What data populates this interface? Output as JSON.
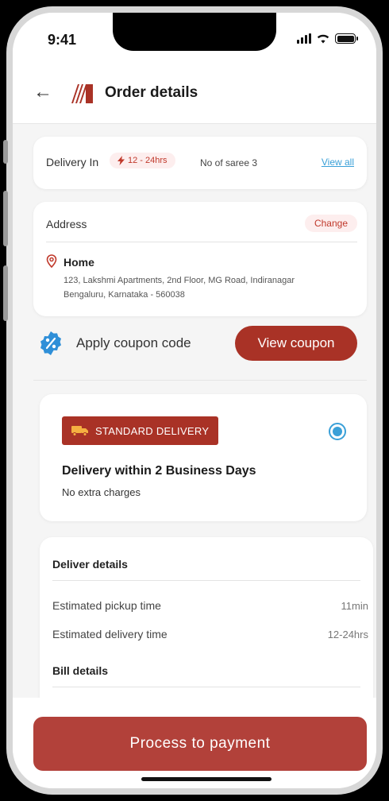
{
  "status": {
    "time": "9:41"
  },
  "header": {
    "title": "Order details"
  },
  "delivery_summary": {
    "label": "Delivery In",
    "eta": "12 - 24hrs",
    "count_text": "No of saree 3",
    "view_all": "View all"
  },
  "address": {
    "label": "Address",
    "change": "Change",
    "name": "Home",
    "line1": "123, Lakshmi Apartments, 2nd Floor, MG Road, Indiranagar",
    "line2": "Bengaluru, Karnataka - 560038"
  },
  "coupon": {
    "text": "Apply coupon code",
    "button": "View coupon"
  },
  "delivery_option": {
    "badge": "STANDARD DELIVERY",
    "title": "Delivery within 2 Business Days",
    "subtitle": "No extra charges",
    "selected": true
  },
  "details": {
    "deliver_heading": "Deliver details",
    "rows": [
      {
        "label": "Estimated pickup time",
        "value": "11min"
      },
      {
        "label": "Estimated delivery time",
        "value": "12-24hrs"
      }
    ],
    "bill_heading": "Bill details"
  },
  "footer": {
    "pay_button": "Process to payment"
  },
  "colors": {
    "accent": "#a93226",
    "link": "#3aa0d8"
  }
}
